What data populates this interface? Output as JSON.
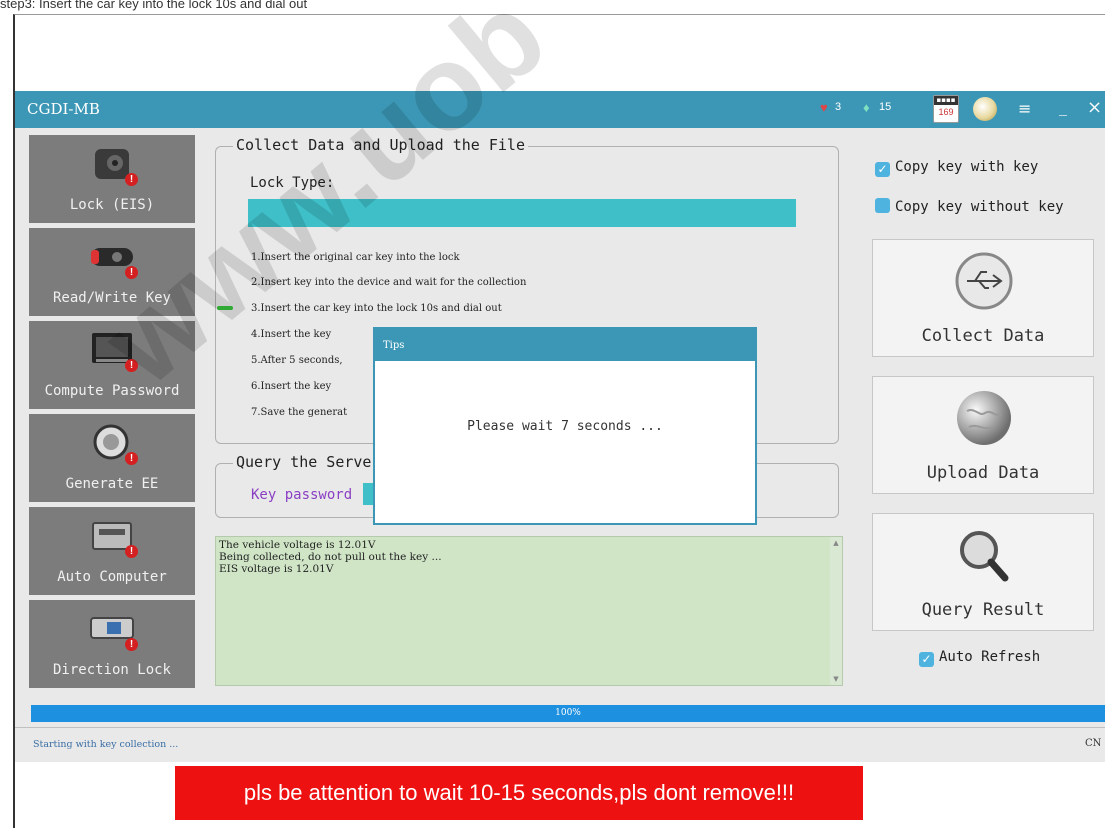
{
  "caption": "step3: Insert the car key into the lock 10s and dial out",
  "window": {
    "title": "CGDI-MB",
    "counts": {
      "hearts": "3",
      "diamonds": "15"
    },
    "calendar": "169",
    "controls": {
      "menu": "≡",
      "minimize": "_",
      "close": "×"
    }
  },
  "sidebar": {
    "items": [
      {
        "label": "Lock (EIS)",
        "icon": "lock-icon"
      },
      {
        "label": "Read/Write Key",
        "icon": "car-key-icon"
      },
      {
        "label": "Compute Password",
        "icon": "computer-icon"
      },
      {
        "label": "Generate EE",
        "icon": "chip-key-icon"
      },
      {
        "label": "Auto Computer",
        "icon": "ecu-icon"
      },
      {
        "label": "Direction Lock",
        "icon": "steering-lock-icon"
      }
    ]
  },
  "collect": {
    "legend": "Collect Data and Upload the File",
    "lock_type_label": "Lock Type:",
    "steps": [
      "1.Insert the original car key into the lock",
      "2.Insert key into the device and wait for the collection",
      "3.Insert the car key into the lock 10s and dial out",
      "4.Insert the key",
      "5.After 5 seconds,",
      "6.Insert the key",
      "7.Save the generat"
    ]
  },
  "query": {
    "legend": "Query the Serve",
    "key_password_label": "Key password"
  },
  "log": {
    "lines": [
      "The vehicle voltage is 12.01V",
      "Being collected, do not pull out the key ...",
      "EIS voltage is 12.01V"
    ]
  },
  "right": {
    "copy_with_key": "Copy key with key",
    "copy_without_key": "Copy key without key",
    "collect_button": "Collect Data",
    "upload_button": "Upload  Data",
    "query_button": "Query Result",
    "auto_refresh": "Auto Refresh",
    "copy_with_key_checked": true,
    "copy_without_key_checked": false,
    "auto_refresh_checked": true
  },
  "modal": {
    "title": "Tips",
    "message": "Please wait 7 seconds ..."
  },
  "progress": {
    "value": 1.0,
    "label": "100%"
  },
  "status": {
    "text": "Starting with key collection ...",
    "lang": "CN"
  },
  "banner": "pls be attention to wait 10-15 seconds,pls dont remove!!!",
  "colors": {
    "accent": "#3b97b5",
    "log_bg": "#cfe5c6",
    "progress": "#1e90e0",
    "banner": "#ee1111"
  }
}
